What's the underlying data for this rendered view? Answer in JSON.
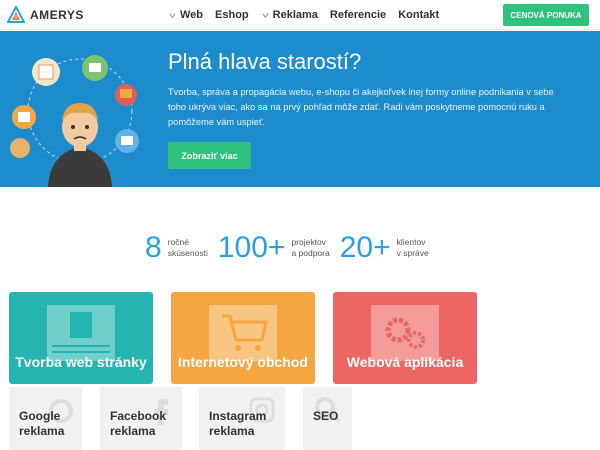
{
  "brand": {
    "name": "AMERYS"
  },
  "nav": {
    "items": [
      {
        "label": "Web",
        "has_dropdown": true
      },
      {
        "label": "Eshop",
        "has_dropdown": false
      },
      {
        "label": "Reklama",
        "has_dropdown": true
      },
      {
        "label": "Referencie",
        "has_dropdown": false
      },
      {
        "label": "Kontakt",
        "has_dropdown": false
      }
    ],
    "cta_label": "CENOVÁ PONUKA"
  },
  "hero": {
    "title": "Plná hlava starostí?",
    "text": "Tvorba, správa a propagácia webu, e-shopu či akejkoľvek inej formy online podnikania v sebe toho ukrýva viac, ako sa na prvý pohľad môže zdať. Radi vám poskytneme pomocnú ruku a pomôžeme vám uspieť.",
    "button_label": "Zobraziť viac"
  },
  "stats": [
    {
      "number": "8",
      "label_line1": "ročné",
      "label_line2": "skúsenosti"
    },
    {
      "number": "100+",
      "label_line1": "projektov",
      "label_line2": "a podpora"
    },
    {
      "number": "20+",
      "label_line1": "klientov",
      "label_line2": "v správe"
    }
  ],
  "services": [
    {
      "label": "Tvorba web stránky",
      "color": "#25b5b0",
      "icon": "user-profile-icon"
    },
    {
      "label": "Internetový obchod",
      "color": "#f5a640",
      "icon": "shopping-cart-icon"
    },
    {
      "label": "Webová aplikácia",
      "color": "#ec6663",
      "icon": "gears-icon"
    }
  ],
  "small_services": [
    {
      "line1": "Google",
      "line2": "reklama",
      "icon": "google-icon"
    },
    {
      "line1": "Facebook",
      "line2": "reklama",
      "icon": "facebook-icon"
    },
    {
      "line1": "Instagram",
      "line2": "reklama",
      "icon": "instagram-icon"
    },
    {
      "line1": "SEO",
      "line2": "",
      "icon": "magnifier-icon"
    }
  ],
  "colors": {
    "hero_bg": "#1d8ccd",
    "accent_green": "#2ec27e",
    "stat_blue": "#2d9fe0"
  }
}
